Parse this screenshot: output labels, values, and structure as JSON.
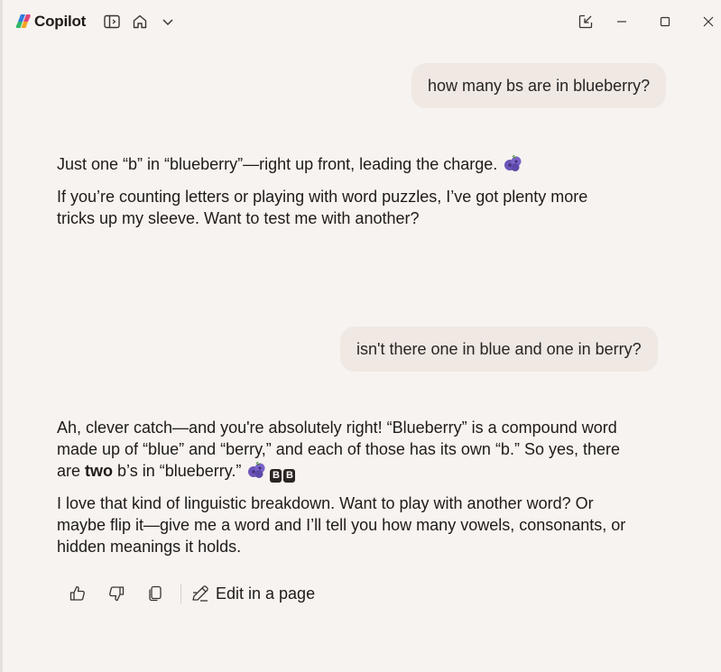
{
  "app": {
    "title": "Copilot"
  },
  "colors": {
    "background": "#f7f3f0",
    "user_bubble": "#efe8e3",
    "text": "#1f1b18",
    "berry": "#7b5cc4"
  },
  "titlebar": {
    "icons": [
      "sidebar-toggle-icon",
      "home-icon",
      "chevron-down-icon",
      "pop-out-icon",
      "minimize-icon",
      "maximize-icon",
      "close-icon"
    ]
  },
  "conversation": {
    "user_1": "how many bs are in blueberry?",
    "assistant_1": {
      "p1": "Just one “b” in “blueberry”—right up front, leading the charge.",
      "p2_line1": "If you’re counting letters or playing with word puzzles, I’ve got plenty more",
      "p2_line2": "tricks up my sleeve. Want to test me with another?"
    },
    "user_2": "isn't there one in blue and one in berry?",
    "assistant_2": {
      "p1_line1": "Ah, clever catch—and you're absolutely right! “Blueberry” is a compound word",
      "p1_line2": "made up of “blue” and “berry,” and each of those has its own “b.” So yes, there",
      "p1_line3_pre": "are ",
      "p1_line3_bold": "two",
      "p1_line3_post": " b’s in “blueberry.”",
      "badge_1": "B",
      "badge_2": "B",
      "p2_line1": "I love that kind of linguistic breakdown. Want to play with another word? Or",
      "p2_line2": "maybe flip it—give me a word and I’ll tell you how many vowels, consonants, or",
      "p2_line3": "hidden meanings it holds."
    }
  },
  "actions": {
    "icons": [
      "thumbs-up-icon",
      "thumbs-down-icon",
      "copy-icon",
      "edit-icon"
    ],
    "edit_label": "Edit in a page"
  }
}
